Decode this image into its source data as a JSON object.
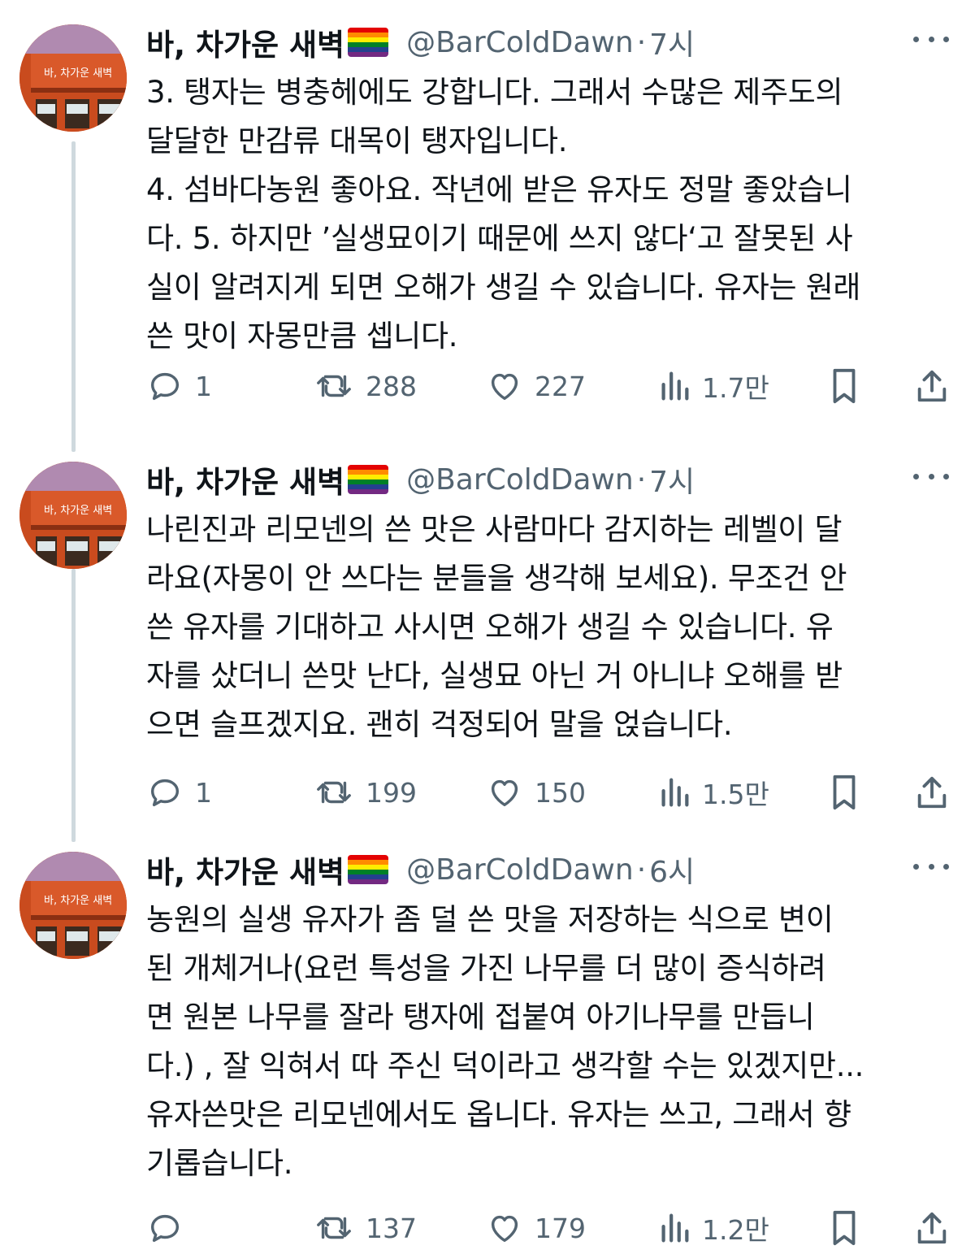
{
  "tweets": [
    {
      "author_name": "바, 차가운 새벽",
      "flag_icon": "rainbow-flag",
      "handle": "@BarColdDawn",
      "separator": "·",
      "time": "7시",
      "text_lines": [
        "3. 탱자는 병충헤에도 강합니다. 그래서 수많은 제주도의",
        "달달한 만감류 대목이 탱자입니다.",
        "4. 섬바다농원 좋아요. 작년에 받은 유자도 정말 좋았습니",
        "다. 5. 하지만 ’실생묘이기 때문에 쓰지 않다‘고 잘못된 사",
        "실이 알려지게 되면 오해가 생길 수 있습니다. 유자는 원래",
        "쓴 맛이 자몽만큼 셉니다."
      ],
      "stats": {
        "replies": "1",
        "retweets": "288",
        "likes": "227",
        "views": "1.7만"
      }
    },
    {
      "author_name": "바, 차가운 새벽",
      "flag_icon": "rainbow-flag",
      "handle": "@BarColdDawn",
      "separator": "·",
      "time": "7시",
      "text_lines": [
        "나린진과 리모넨의 쓴 맛은 사람마다 감지하는 레벨이 달",
        "라요(자몽이 안 쓰다는 분들을 생각해 보세요). 무조건 안",
        "쓴 유자를 기대하고 사시면 오해가 생길 수 있습니다. 유",
        "자를 샀더니 쓴맛 난다, 실생묘 아닌 거 아니냐 오해를 받",
        "으면 슬프겠지요. 괜히 걱정되어 말을 얹습니다."
      ],
      "stats": {
        "replies": "1",
        "retweets": "199",
        "likes": "150",
        "views": "1.5만"
      }
    },
    {
      "author_name": "바, 차가운 새벽",
      "flag_icon": "rainbow-flag",
      "handle": "@BarColdDawn",
      "separator": "·",
      "time": "6시",
      "text_lines": [
        "농원의 실생 유자가 좀 덜 쓴 맛을 저장하는 식으로 변이",
        "된 개체거나(요런 특성을 가진 나무를 더 많이 증식하려",
        "면 원본 나무를 잘라 탱자에 접붙여 아기나무를 만듭니",
        "다.) , 잘 익혀서 따 주신 덕이라고 생각할 수는 있겠지만...",
        "유자쓴맛은 리모넨에서도 옵니다. 유자는 쓰고, 그래서 향",
        "기롭습니다."
      ],
      "stats": {
        "replies": "",
        "retweets": "137",
        "likes": "179",
        "views": "1.2만"
      }
    }
  ],
  "avatar": {
    "sign_text": "바, 차가운 새벽"
  },
  "colors": {
    "text_primary": "#0f1419",
    "text_secondary": "#536471",
    "thread_line": "#cfd9de",
    "avatar_wall": "#c94b1e",
    "avatar_sky": "#b08ab0"
  },
  "icons": {
    "reply": "reply-icon",
    "retweet": "retweet-icon",
    "like": "heart-icon",
    "views": "views-chart-icon",
    "bookmark": "bookmark-icon",
    "share": "share-icon",
    "more": "more-dots-icon"
  }
}
